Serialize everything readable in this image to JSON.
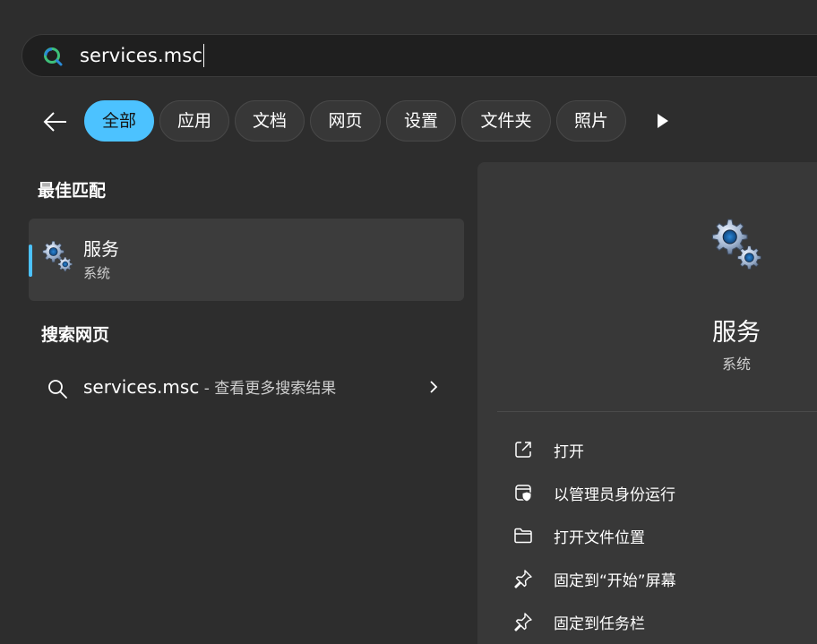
{
  "search": {
    "query": "services.msc"
  },
  "filters": {
    "back_icon": "arrow-left-icon",
    "chips": [
      {
        "label": "全部",
        "active": true
      },
      {
        "label": "应用",
        "active": false
      },
      {
        "label": "文档",
        "active": false
      },
      {
        "label": "网页",
        "active": false
      },
      {
        "label": "设置",
        "active": false
      },
      {
        "label": "文件夹",
        "active": false
      },
      {
        "label": "照片",
        "active": false
      }
    ],
    "more_icon": "play-arrow-icon"
  },
  "best_match": {
    "heading": "最佳匹配",
    "item": {
      "title": "服务",
      "subtitle": "系统",
      "icon": "gears-icon"
    }
  },
  "web_search": {
    "heading": "搜索网页",
    "query": "services.msc",
    "hint": " - 查看更多搜索结果"
  },
  "detail": {
    "title": "服务",
    "subtitle": "系统",
    "actions": [
      {
        "label": "打开",
        "icon": "open-external-icon"
      },
      {
        "label": "以管理员身份运行",
        "icon": "admin-shield-icon"
      },
      {
        "label": "打开文件位置",
        "icon": "folder-icon"
      },
      {
        "label": "固定到“开始”屏幕",
        "icon": "pin-icon"
      },
      {
        "label": "固定到任务栏",
        "icon": "pin-icon"
      }
    ]
  },
  "colors": {
    "accent": "#4cc2ff",
    "background": "#2d2d2d",
    "panel": "#383838"
  }
}
